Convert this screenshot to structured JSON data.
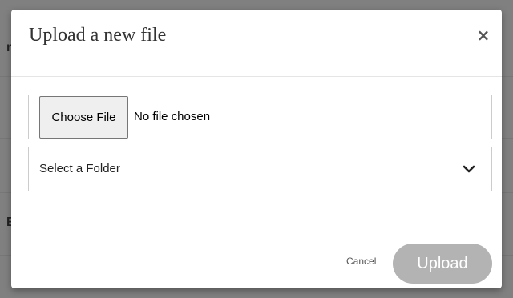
{
  "background": {
    "fragments": [
      "r",
      "E"
    ]
  },
  "modal": {
    "title": "Upload a new file",
    "close_icon": "×",
    "file_input": {
      "button_label": "Choose File",
      "status": "No file chosen"
    },
    "folder_select": {
      "selected": "Select a Folder"
    },
    "footer": {
      "cancel_label": "Cancel",
      "upload_label": "Upload"
    }
  },
  "colors": {
    "overlay": "#808080",
    "upload_button_disabled": "#b3b3b3",
    "border": "#cccccc"
  }
}
